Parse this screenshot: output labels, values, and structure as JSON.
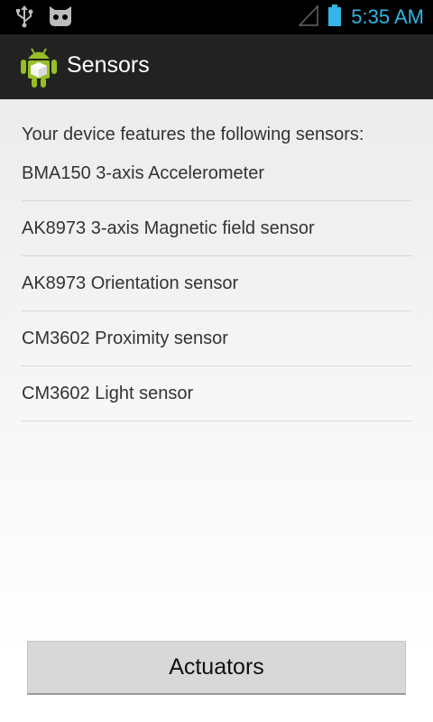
{
  "status_bar": {
    "time": "5:35 AM",
    "icons": [
      "usb-icon",
      "cyanogen-icon",
      "signal-icon",
      "battery-icon"
    ],
    "accent_color": "#33b5e5"
  },
  "action_bar": {
    "title": "Sensors",
    "icon": "android-cube-icon"
  },
  "main": {
    "intro": "Your device features the following sensors:",
    "sensors": [
      "BMA150 3-axis Accelerometer",
      "AK8973 3-axis Magnetic field sensor",
      "AK8973 Orientation sensor",
      "CM3602 Proximity sensor",
      "CM3602 Light sensor"
    ],
    "button_label": "Actuators"
  }
}
